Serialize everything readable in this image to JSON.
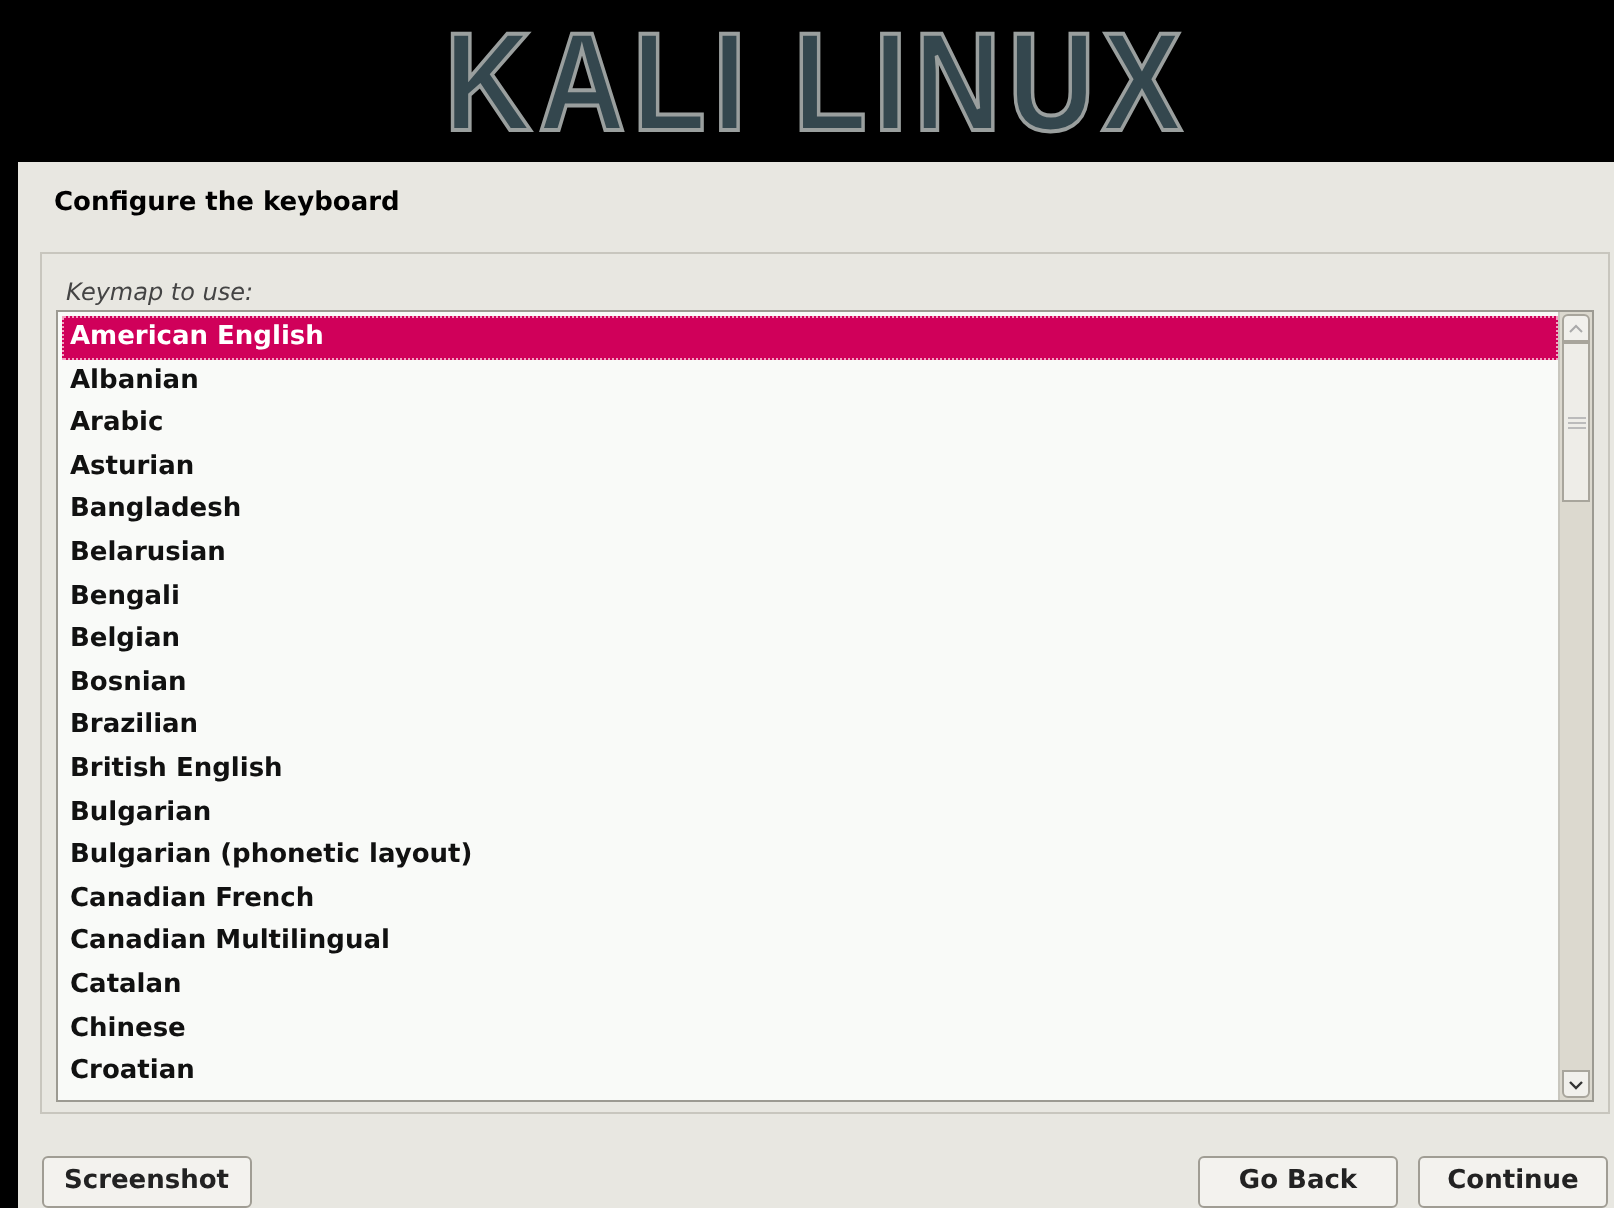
{
  "banner": {
    "logo": "KALI LINUX"
  },
  "title": "Configure the keyboard",
  "prompt": "Keymap to use:",
  "keymaps": [
    {
      "label": "American English",
      "selected": true
    },
    {
      "label": "Albanian",
      "selected": false
    },
    {
      "label": "Arabic",
      "selected": false
    },
    {
      "label": "Asturian",
      "selected": false
    },
    {
      "label": "Bangladesh",
      "selected": false
    },
    {
      "label": "Belarusian",
      "selected": false
    },
    {
      "label": "Bengali",
      "selected": false
    },
    {
      "label": "Belgian",
      "selected": false
    },
    {
      "label": "Bosnian",
      "selected": false
    },
    {
      "label": "Brazilian",
      "selected": false
    },
    {
      "label": "British English",
      "selected": false
    },
    {
      "label": "Bulgarian",
      "selected": false
    },
    {
      "label": "Bulgarian (phonetic layout)",
      "selected": false
    },
    {
      "label": "Canadian French",
      "selected": false
    },
    {
      "label": "Canadian Multilingual",
      "selected": false
    },
    {
      "label": "Catalan",
      "selected": false
    },
    {
      "label": "Chinese",
      "selected": false
    },
    {
      "label": "Croatian",
      "selected": false
    }
  ],
  "buttons": {
    "left": [
      "Screenshot"
    ],
    "right": [
      "Go Back",
      "Continue"
    ]
  }
}
